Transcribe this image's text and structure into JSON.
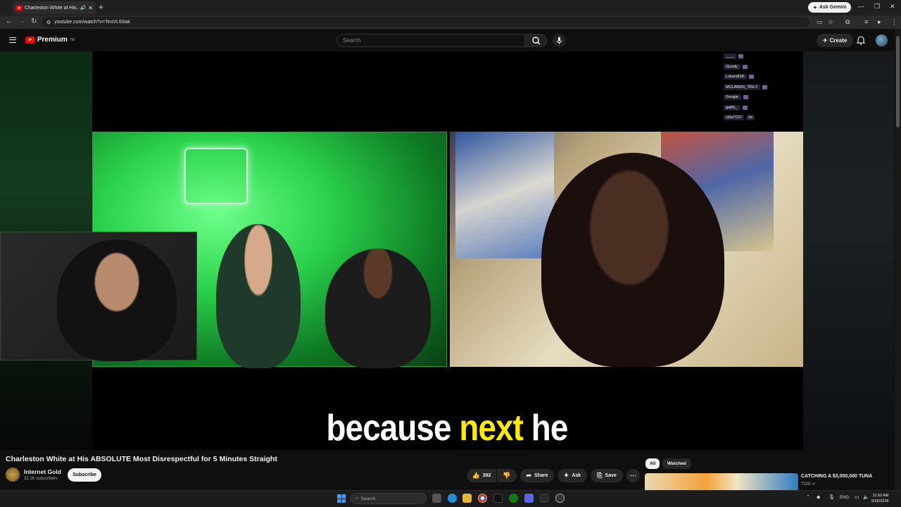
{
  "browser": {
    "tab_title": "Charleston White at His AB",
    "new_tab": "+",
    "ask_gemini": "Ask Gemini",
    "url": "youtube.com/watch?v=TenVL6iiiak"
  },
  "header": {
    "logo_text": "Premium",
    "logo_sup": "TM",
    "search_placeholder": "Search",
    "create_label": "Create"
  },
  "chat": [
    {
      "name": "____"
    },
    {
      "name": "Gizzdy:"
    },
    {
      "name": "Lokers818:"
    },
    {
      "name": "MCLAREN_765LT:"
    },
    {
      "name": "Googie:"
    },
    {
      "name": "gabfx_:"
    },
    {
      "name": "sktaTCO:",
      "msg": "lol"
    }
  ],
  "caption": {
    "part1": "because ",
    "highlight": "next",
    "part2": " he"
  },
  "video": {
    "title": "Charleston White at His ABSOLUTE Most Disrespectful for 5 Minutes Straight",
    "channel": "Internet Gold",
    "subscribers": "32.1K subscribers",
    "subscribe_label": "Subscribe",
    "likes": "392",
    "share_label": "Share",
    "ask_label": "Ask",
    "save_label": "Save"
  },
  "sidebar": {
    "chip_all": "All",
    "chip_watched": "Watched",
    "rec_title": "CATCHING A $3,000,000 TUNA",
    "rec_channel": "TOSI"
  },
  "taskbar": {
    "search_placeholder": "Search",
    "lang": "ENG",
    "time": "11:53 AM",
    "date": "6/26/2026"
  },
  "colors": {
    "accent_red": "#ff0000",
    "caption_highlight": "#ffeb00",
    "background": "#0f0f0f"
  }
}
